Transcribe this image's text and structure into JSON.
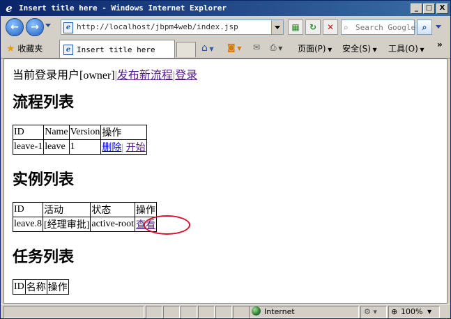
{
  "window": {
    "title": "Insert title here - Windows Internet Explorer",
    "minimize": "_",
    "maximize": "□",
    "close": "X"
  },
  "toolbar": {
    "back": "←",
    "forward": "→",
    "address": "http://localhost/jbpm4web/index.jsp",
    "search_placeholder": "Search Google"
  },
  "tabs": {
    "favorites": "收藏夹",
    "active_tab": "Insert title here",
    "page_menu": "页面(P)",
    "safety_menu": "安全(S)",
    "tools_menu": "工具(O)"
  },
  "page": {
    "login_prefix": "当前登录用户[owner]",
    "deploy_link": "发布新流程",
    "login_link": "登录",
    "process_heading": "流程列表",
    "process_table": {
      "headers": [
        "ID",
        "Name",
        "Version",
        "操作"
      ],
      "rows": [
        {
          "id": "leave-1",
          "name": "leave",
          "version": "1",
          "delete": "删除",
          "start": "开始"
        }
      ]
    },
    "instance_heading": "实例列表",
    "instance_table": {
      "headers": [
        "ID",
        "活动",
        "状态",
        "操作"
      ],
      "rows": [
        {
          "id": "leave.8",
          "activity": "[经理审批]",
          "state": "active-root",
          "view": "查看"
        }
      ]
    },
    "task_heading": "任务列表",
    "task_table": {
      "headers": [
        "ID",
        "名称",
        "操作"
      ]
    }
  },
  "statusbar": {
    "zone": "Internet",
    "zoom": "100%"
  },
  "colors": {
    "titlebar": "#0a246a",
    "link_visited": "#551a8b",
    "link": "#0000ee",
    "highlight_oval": "#d8102c"
  }
}
